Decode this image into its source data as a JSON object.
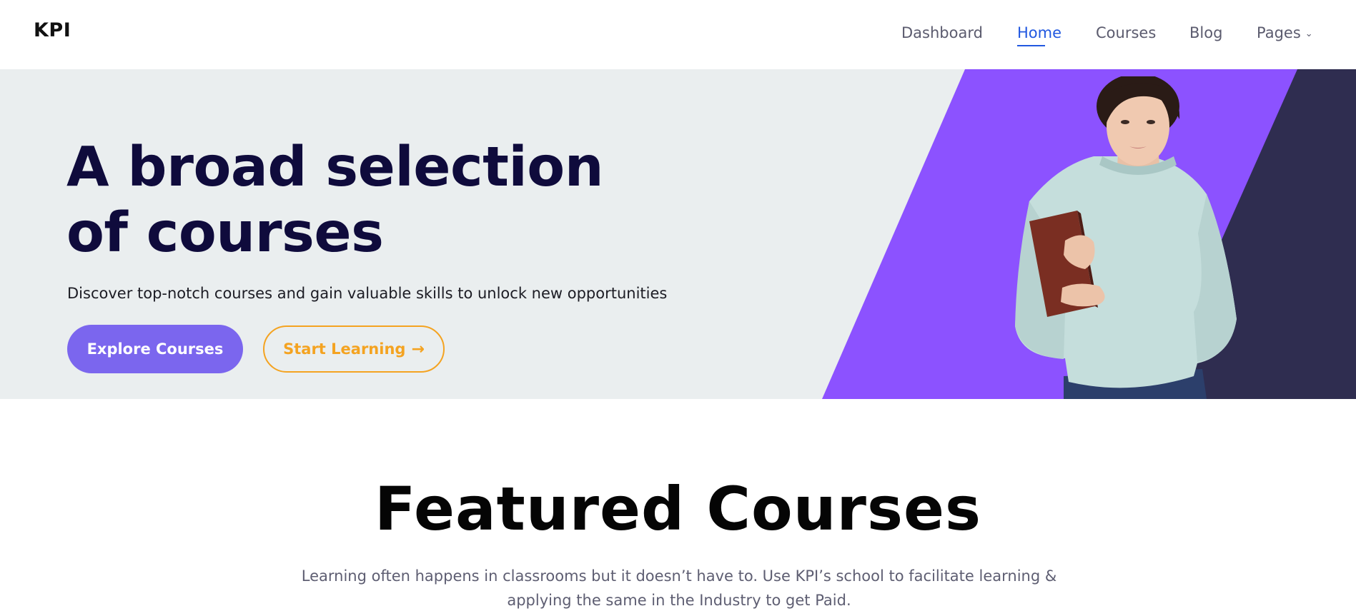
{
  "header": {
    "logo": "KPI",
    "nav": [
      {
        "label": "Dashboard"
      },
      {
        "label": "Home"
      },
      {
        "label": "Courses"
      },
      {
        "label": "Blog"
      },
      {
        "label": "Pages"
      }
    ],
    "active_item": "Home"
  },
  "hero": {
    "title_line1": "A broad selection",
    "title_line2": "of courses",
    "subtitle": "Discover top-notch courses and gain valuable skills to unlock new opportunities",
    "explore_button": "Explore Courses",
    "start_button": "Start Learning"
  },
  "featured": {
    "title": "Featured Courses",
    "description_line1": "Learning often happens in classrooms but it doesn’t have to. Use KPI’s school to facilitate learning &",
    "description_line2": "applying the same in the Industry to get Paid."
  },
  "colors": {
    "accent_blue": "#2158e0",
    "hero_purple": "#8c52ff",
    "hero_navy": "#2f2d50",
    "button_purple": "#7b66ee",
    "button_orange": "#f4a321",
    "title_navy": "#0f0b3c"
  },
  "icons": {
    "pages_dropdown": "chevron-down-icon",
    "start_arrow": "arrow-right-icon"
  }
}
